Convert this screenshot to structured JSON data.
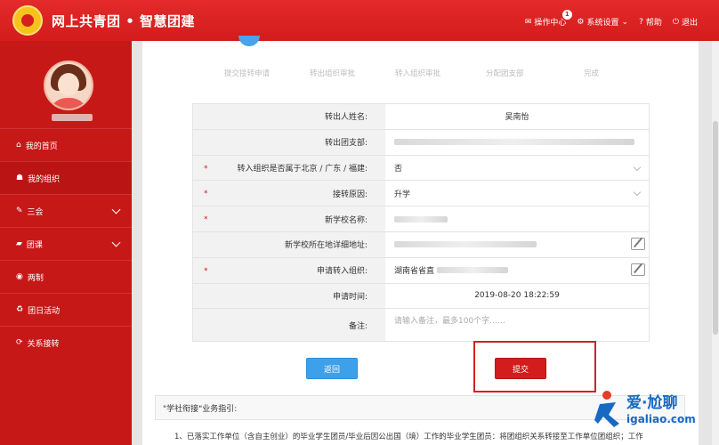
{
  "header": {
    "brand": "网上共青团 • 智慧团建",
    "nav": [
      {
        "label": "操作中心",
        "icon": "envelope-icon",
        "badge": "1"
      },
      {
        "label": "系统设置",
        "icon": "gear-icon"
      },
      {
        "label": "帮助",
        "icon": "help-icon"
      },
      {
        "label": "退出",
        "icon": "power-icon"
      }
    ]
  },
  "sidebar": {
    "items": [
      {
        "label": "我的首页",
        "icon": "home-icon"
      },
      {
        "label": "我的组织",
        "icon": "group-icon"
      },
      {
        "label": "三会",
        "icon": "edit-icon"
      },
      {
        "label": "团课",
        "icon": "folder-icon"
      },
      {
        "label": "两制",
        "icon": "circle-icon"
      },
      {
        "label": "团日活动",
        "icon": "recycle-icon"
      },
      {
        "label": "关系接转",
        "icon": "refresh-icon"
      }
    ]
  },
  "steps": [
    "提交接转申请",
    "转出组织审批",
    "转入组织审批",
    "分配团支部",
    "完成"
  ],
  "form": {
    "rows": [
      {
        "label": "转出人姓名:",
        "value": "吴南怡",
        "required": false
      },
      {
        "label": "转出团支部:",
        "value": "",
        "required": false
      },
      {
        "label": "转入组织是否属于北京 / 广东 / 福建:",
        "value": "否",
        "required": true
      },
      {
        "label": "接转原因:",
        "value": "升学",
        "required": true
      },
      {
        "label": "新学校名称:",
        "value": "",
        "required": true
      },
      {
        "label": "新学校所在地详细地址:",
        "value": "",
        "required": false
      },
      {
        "label": "申请转入组织:",
        "value": "湖南省省直",
        "required": true
      },
      {
        "label": "申请时间:",
        "value": "2019-08-20 18:22:59",
        "required": false
      },
      {
        "label": "备注:",
        "placeholder": "请输入备注，最多100个字……",
        "required": false
      }
    ],
    "required_mark": "*"
  },
  "buttons": {
    "back": "返回",
    "submit": "提交"
  },
  "guide": {
    "title": "\"学社衔接\"业务指引:",
    "text": "1、已落实工作单位（含自主创业）的毕业学生团员/毕业后因公出国（境）工作的毕业学生团员：将团组织关系转接至工作单位团组织；工作"
  },
  "watermark": {
    "brand": "爱·尬聊",
    "url": "igaliao.com",
    "colors": {
      "primary": "#1769c2",
      "accent": "#e63b2a"
    }
  },
  "colors": {
    "header": "#d31c1c",
    "sidebar": "#c71818",
    "primary_button": "#3fa0ea",
    "submit_button": "#d31c1c"
  }
}
